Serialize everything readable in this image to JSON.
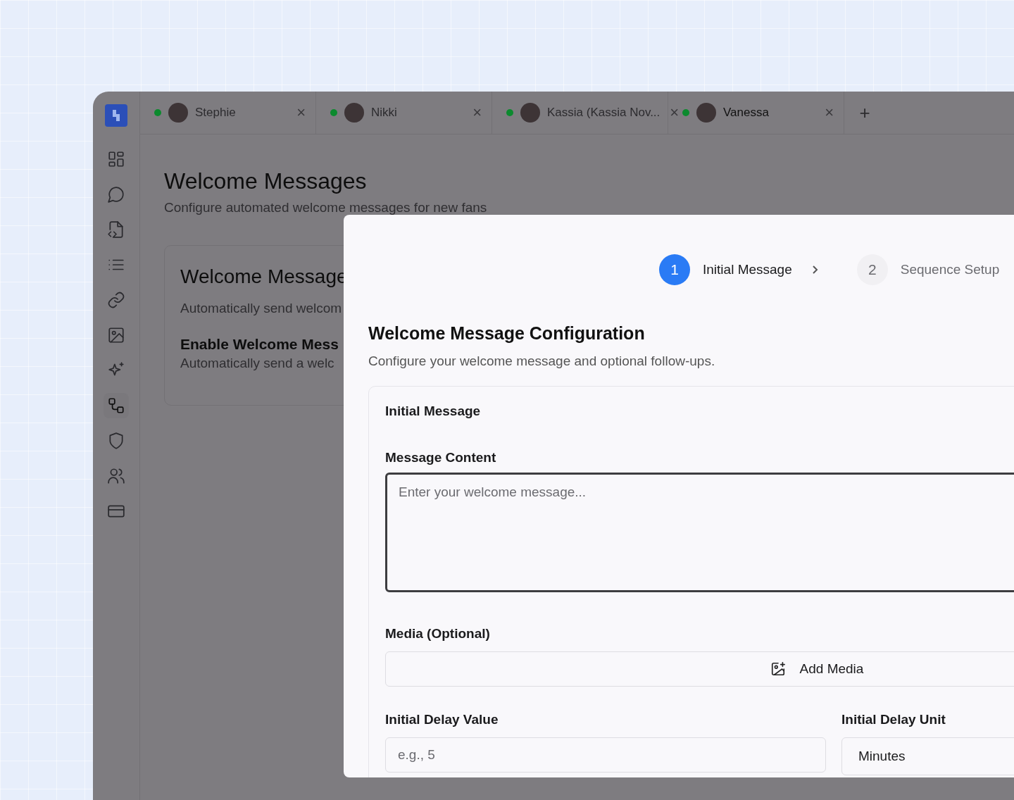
{
  "sidebar": {
    "items": [
      {
        "kind": "logo"
      },
      {
        "kind": "grid",
        "selected": false
      },
      {
        "kind": "chat",
        "selected": false
      },
      {
        "kind": "code-file",
        "selected": false
      },
      {
        "kind": "list",
        "selected": false
      },
      {
        "kind": "link",
        "selected": false
      },
      {
        "kind": "image",
        "selected": false
      },
      {
        "kind": "sparkle",
        "selected": false
      },
      {
        "kind": "flow",
        "selected": true
      },
      {
        "kind": "shield",
        "selected": false
      },
      {
        "kind": "users",
        "selected": false
      },
      {
        "kind": "card",
        "selected": false
      }
    ]
  },
  "tabs": [
    {
      "name": "Stephie",
      "online": true,
      "selected": false,
      "close": "×"
    },
    {
      "name": "Nikki",
      "online": true,
      "selected": false,
      "close": "×"
    },
    {
      "name": "Kassia (Kassia Nov...",
      "online": true,
      "selected": false,
      "close": "×"
    },
    {
      "name": "Vanessa",
      "online": true,
      "selected": true,
      "close": "×"
    }
  ],
  "new_tab": "+",
  "page": {
    "title": "Welcome Messages",
    "subtitle": "Configure automated welcome messages for new fans",
    "card": {
      "title": "Welcome Message",
      "description": "Automatically send welcom",
      "toggle_label": "Enable Welcome Mess",
      "toggle_description": "Automatically send a welc"
    }
  },
  "dialog": {
    "steps": [
      {
        "number": "1",
        "label": "Initial Message",
        "selected": true
      },
      {
        "number": "2",
        "label": "Sequence Setup",
        "selected": false
      }
    ],
    "title": "Welcome Message Configuration",
    "subtitle": "Configure your welcome message and optional follow-ups.",
    "section": {
      "title": "Initial Message",
      "message_label": "Message Content",
      "message_placeholder": "Enter your welcome message...",
      "media_label": "Media (Optional)",
      "media_button": "Add Media",
      "delay_value_label": "Initial Delay Value",
      "delay_value_placeholder": "e.g., 5",
      "delay_unit_label": "Initial Delay Unit",
      "delay_unit_value": "Minutes"
    }
  }
}
